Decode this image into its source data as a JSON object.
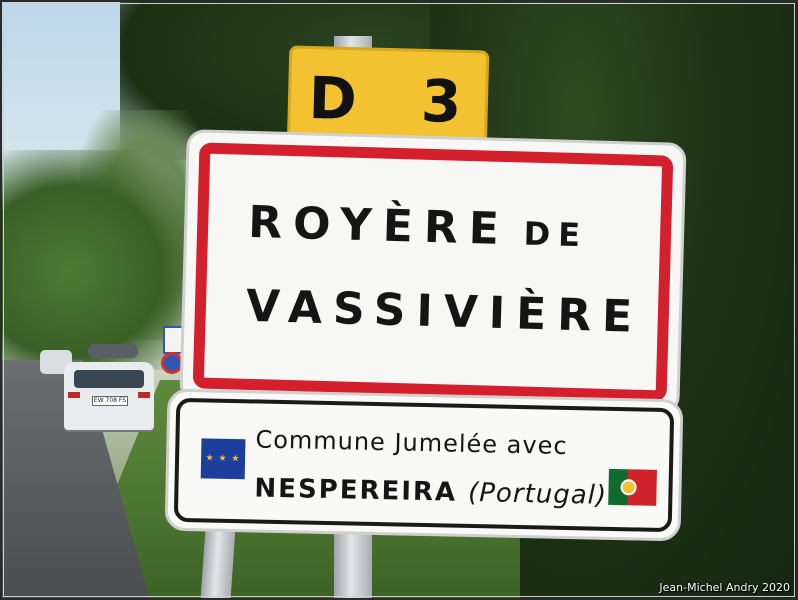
{
  "route_sign": {
    "text": "D 3",
    "color": "#f2c230"
  },
  "town_sign": {
    "line1": "ROYÈRE",
    "line1_suffix": "DE",
    "line2": "VASSIVIÈRE",
    "border_color": "#d41f2d"
  },
  "twin_sign": {
    "line1": "Commune Jumelée avec",
    "line2_name": "NESPEREIRA",
    "line2_country": "(Portugal)",
    "left_flag": "eu-flag",
    "right_flag": "portugal-flag"
  },
  "car": {
    "plate_text": "EW 708 FS"
  },
  "credit": "Jean-Michel Andry 2020"
}
